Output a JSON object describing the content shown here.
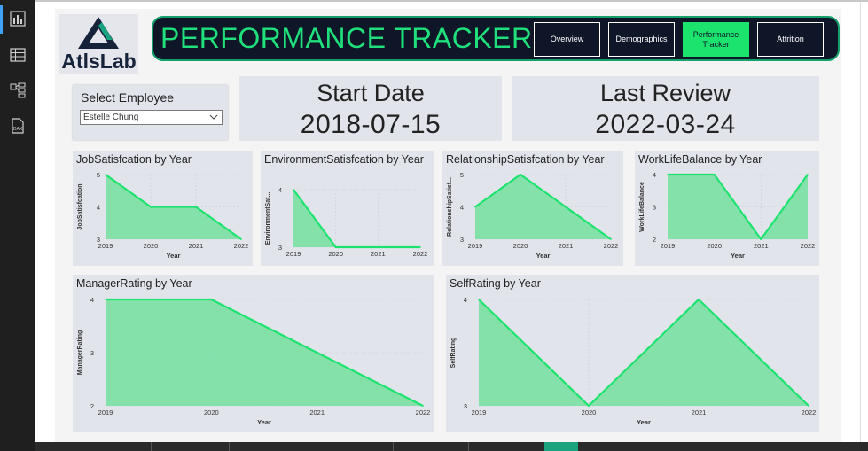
{
  "app": {
    "left_nav": [
      {
        "icon": "report-view-icon",
        "active": true
      },
      {
        "icon": "table-view-icon",
        "active": false
      },
      {
        "icon": "model-view-icon",
        "active": false
      },
      {
        "icon": "dax-query-view-icon",
        "active": false
      }
    ]
  },
  "logo": {
    "text": "AtlsLab"
  },
  "header": {
    "title": "PERFORMANCE TRACKER",
    "nav_buttons": [
      {
        "label": "Overview",
        "active": false
      },
      {
        "label": "Demographics",
        "active": false
      },
      {
        "label": "Performance Tracker",
        "active": true
      },
      {
        "label": "Attrition",
        "active": false
      }
    ]
  },
  "slicer": {
    "title": "Select Employee",
    "selected": "Estelle Chung"
  },
  "kpis": [
    {
      "label": "Start Date",
      "value": "2018-07-15"
    },
    {
      "label": "Last Review",
      "value": "2022-03-24"
    }
  ],
  "colors": {
    "line": "#1ce36e",
    "area": "#7fe0a6",
    "card": "#e2e4ec",
    "header_bg": "#0e1628"
  },
  "chart_data": [
    {
      "type": "area",
      "title": "JobSatisfcation by Year",
      "xlabel": "Year",
      "ylabel": "JobSatisfcation",
      "x": [
        "2019",
        "2020",
        "2021",
        "2022"
      ],
      "y": [
        5,
        4,
        4,
        3
      ],
      "yticks": [
        "5",
        "4",
        "3"
      ],
      "ylim": [
        3,
        5
      ]
    },
    {
      "type": "area",
      "title": "EnvironmentSatisfcation by Year",
      "xlabel": "",
      "ylabel": "EnvironmentSat...",
      "x": [
        "2019",
        "2020",
        "2021",
        "2022"
      ],
      "y": [
        4,
        3,
        3,
        3
      ],
      "yticks": [
        "4",
        "3"
      ],
      "ylim": [
        3,
        4
      ]
    },
    {
      "type": "area",
      "title": "RelationshipSatisfcation by Year",
      "xlabel": "Year",
      "ylabel": "RelationshipSatisf...",
      "x": [
        "2019",
        "2020",
        "2021",
        "2022"
      ],
      "y": [
        4,
        5,
        4,
        3
      ],
      "yticks": [
        "5",
        "4",
        "3"
      ],
      "ylim": [
        3,
        5
      ]
    },
    {
      "type": "area",
      "title": "WorkLifeBalance by Year",
      "xlabel": "Year",
      "ylabel": "WorkLifeBalance",
      "x": [
        "2019",
        "2020",
        "2021",
        "2022"
      ],
      "y": [
        4,
        4,
        2,
        4
      ],
      "yticks": [
        "4",
        "3",
        "2"
      ],
      "ylim": [
        2,
        4
      ]
    },
    {
      "type": "area",
      "title": "ManagerRating by Year",
      "xlabel": "Year",
      "ylabel": "ManagerRating",
      "x": [
        "2019",
        "2020",
        "2021",
        "2022"
      ],
      "y": [
        4,
        4,
        3,
        2
      ],
      "yticks": [
        "4",
        "3",
        "2"
      ],
      "ylim": [
        2,
        4
      ]
    },
    {
      "type": "area",
      "title": "SelfRating by Year",
      "xlabel": "Year",
      "ylabel": "SelfRating",
      "x": [
        "2019",
        "2020",
        "2021",
        "2022"
      ],
      "y": [
        4,
        3,
        4,
        3
      ],
      "yticks": [
        "4",
        "3"
      ],
      "ylim": [
        3,
        4
      ]
    }
  ]
}
